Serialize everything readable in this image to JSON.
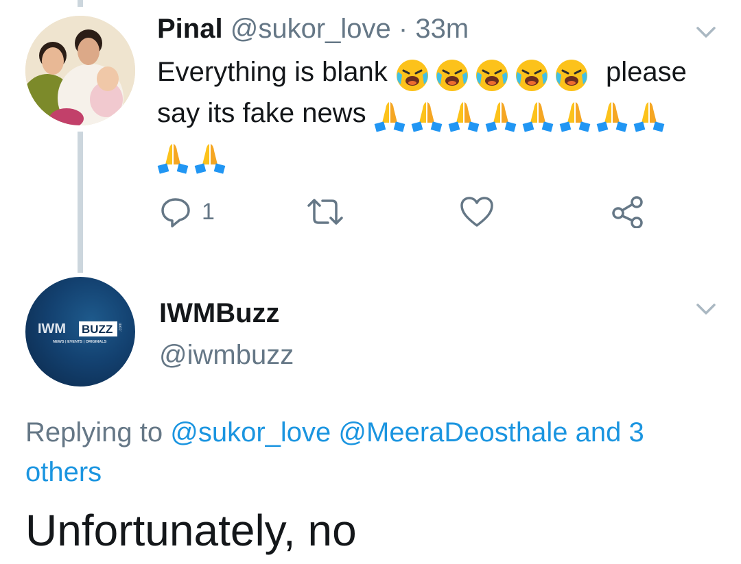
{
  "tweet1": {
    "display_name": "Pinal",
    "handle": "@sukor_love",
    "separator": "·",
    "time": "33m",
    "text_part1": "Everything is blank",
    "text_part2": "please",
    "text_part3": "say its fake news",
    "emoji_sequence_1": [
      "crying-face-emoji",
      "crying-face-emoji",
      "crying-face-emoji",
      "crying-face-emoji",
      "crying-face-emoji"
    ],
    "emoji_sequence_2": [
      "folded-hands-emoji",
      "folded-hands-emoji",
      "folded-hands-emoji",
      "folded-hands-emoji",
      "folded-hands-emoji",
      "folded-hands-emoji",
      "folded-hands-emoji",
      "folded-hands-emoji",
      "folded-hands-emoji",
      "folded-hands-emoji"
    ],
    "reply_count": "1",
    "icons": [
      "reply-icon",
      "retweet-icon",
      "like-icon",
      "share-icon",
      "chevron-down-icon"
    ]
  },
  "tweet2": {
    "display_name": "IWMBuzz",
    "handle": "@iwmbuzz",
    "replying_prefix": "Replying to",
    "replying_to_1": "@sukor_love",
    "replying_to_2": "@MeeraDeosthale",
    "replying_to_others_a": "and 3",
    "replying_to_others_b": "others",
    "text": "Unfortunately, no",
    "avatar_logo": {
      "main": "IWM",
      "badge": "BUZZ",
      "tagline": "NEWS | EVENTS | ORIGINALS",
      "side": ".com"
    }
  },
  "colors": {
    "text": "#14171a",
    "secondary": "#657786",
    "link": "#1b95e0",
    "thread_line": "#ccd6dd"
  }
}
